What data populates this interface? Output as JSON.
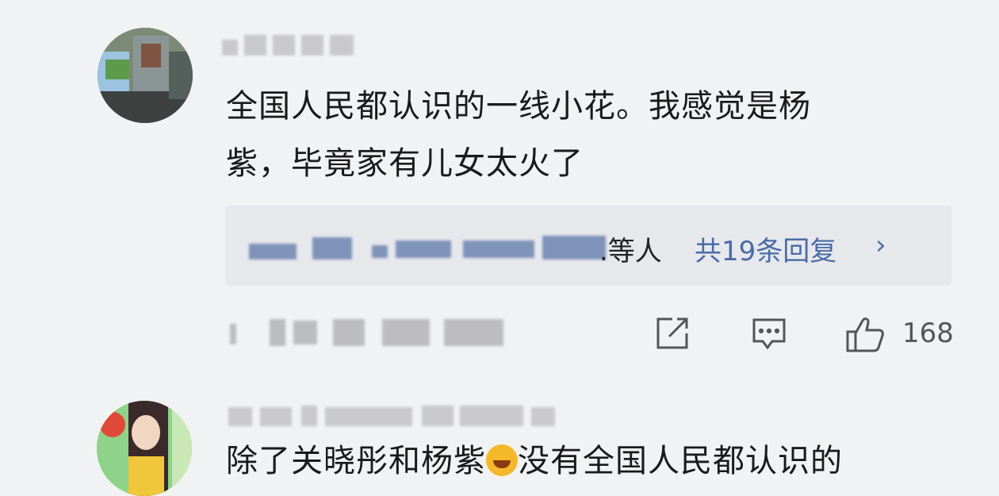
{
  "comments": [
    {
      "text_line1": "全国人民都认识的一线小花。我感觉是杨",
      "text_line2": "紫，毕竟家有儿女太火了",
      "reply_suffix": ".等人",
      "reply_count": "共19条回复",
      "reply_arrow": "›",
      "like_count": "168"
    },
    {
      "text_before_emoji": "除了关晓彤和杨紫",
      "text_after_emoji": "没有全国人民都认识的"
    }
  ]
}
